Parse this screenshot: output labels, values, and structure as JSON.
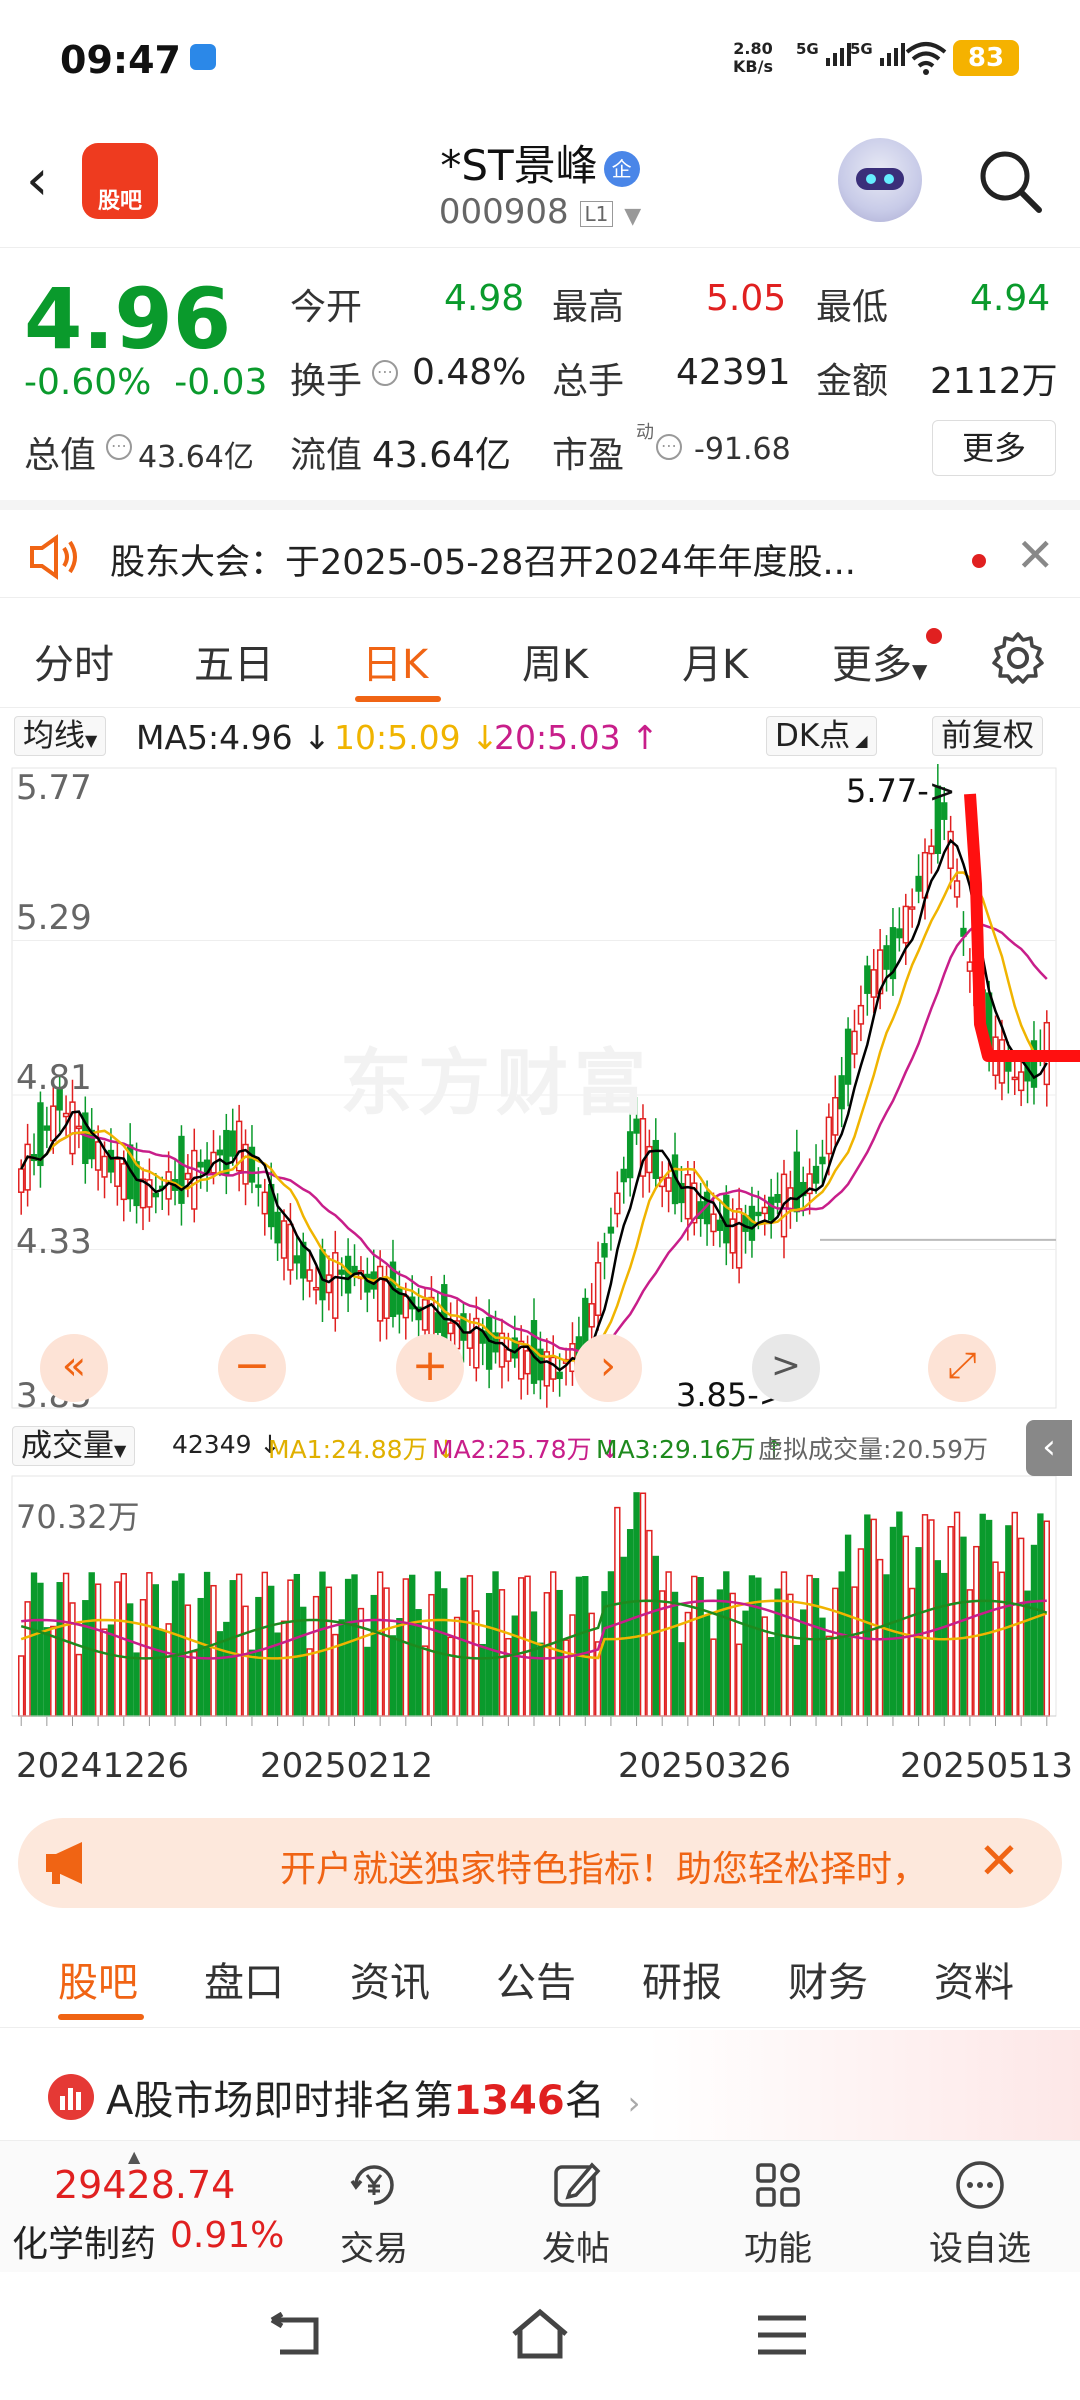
{
  "status_bar": {
    "time": "09:47",
    "net_speed": "2.80",
    "net_unit": "KB/s",
    "sig1": "5G",
    "sig2": "5G",
    "battery": "83"
  },
  "header": {
    "app_logo": "股吧",
    "stock_name": "*ST景峰",
    "badge": "企",
    "stock_code": "000908",
    "level": "L1"
  },
  "quote": {
    "price": "4.96",
    "change_pct": "-0.60%",
    "change": "-0.03",
    "open_label": "今开",
    "open": "4.98",
    "high_label": "最高",
    "high": "5.05",
    "low_label": "最低",
    "low": "4.94",
    "turnover_label": "换手",
    "turnover": "0.48%",
    "volume_label": "总手",
    "volume": "42391",
    "amount_label": "金额",
    "amount": "2112万",
    "mktcap_label": "总值",
    "mktcap": "43.64亿",
    "float_label": "流值",
    "float_cap": "43.64亿",
    "pe_label": "市盈",
    "pe_sup": "动",
    "pe": "-91.68",
    "more": "更多"
  },
  "notice": {
    "text": "股东大会：于2025-05-28召开2024年年度股..."
  },
  "chart_tabs": [
    "分时",
    "五日",
    "日K",
    "周K",
    "月K",
    "更多"
  ],
  "chart_tab_active": "日K",
  "ma": {
    "button": "均线",
    "ma5": "MA5:4.96 ↓",
    "ma10": "10:5.09 ↓",
    "ma20": "20:5.03 ↑",
    "dk": "DK点",
    "adjust": "前复权"
  },
  "volume_bar": {
    "button": "成交量",
    "vol": "42349 ↓",
    "ma1": "MA1:24.88万 ↓",
    "ma2": "MA2:25.78万 ↓",
    "ma3": "MA3:29.16万 ↑",
    "virtual": "虚拟成交量:20.59万"
  },
  "chart_data": {
    "type": "candlestick",
    "y_ticks": [
      "5.77",
      "5.29",
      "4.81",
      "4.33",
      "3.85"
    ],
    "ylim": [
      3.85,
      5.77
    ],
    "high_marker": "5.77->",
    "low_marker": "3.85->",
    "volume_max_label": "70.32万",
    "x_labels": [
      "20241226",
      "20250212",
      "20250326",
      "20250513"
    ],
    "watermark": "东方财富",
    "colors": {
      "up": "#e02020",
      "down": "#0a9a2c",
      "ma5": "#000000",
      "ma10": "#f0b400",
      "ma20": "#c81e8a",
      "vol_ma3": "#1e8a1e"
    }
  },
  "promo": {
    "text": "开户就送独家特色指标！助您轻松择时，"
  },
  "bottom_tabs": [
    "股吧",
    "盘口",
    "资讯",
    "公告",
    "研报",
    "财务",
    "资料"
  ],
  "bottom_tab_active": "股吧",
  "rank": {
    "prefix": "A股市场即时排名第",
    "number": "1346",
    "suffix": "名"
  },
  "action_bar": {
    "index_value": "29428.74",
    "index_name": "化学制药",
    "index_change": "0.91%",
    "trade": "交易",
    "post": "发帖",
    "functions": "功能",
    "watchlist": "设自选"
  }
}
